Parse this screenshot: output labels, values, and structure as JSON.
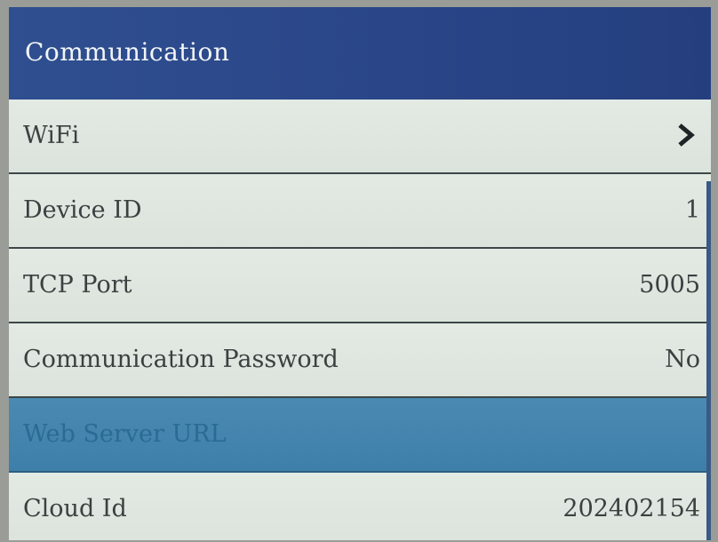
{
  "header": {
    "title": "Communication"
  },
  "menu": {
    "items": [
      {
        "label": "WiFi",
        "value": "",
        "icon": "chevron-right-icon"
      },
      {
        "label": "Device ID",
        "value": "1"
      },
      {
        "label": "TCP Port",
        "value": "5005"
      },
      {
        "label": "Communication Password",
        "value": "No"
      },
      {
        "label": "Web Server URL",
        "value": "",
        "selected": true
      },
      {
        "label": "Cloud Id",
        "value": "202402154"
      }
    ]
  },
  "colors": {
    "header_bg": "#2c4a8c",
    "selected_bg": "#4585ae",
    "row_bg": "#dfe6df",
    "text": "#3a4140"
  }
}
